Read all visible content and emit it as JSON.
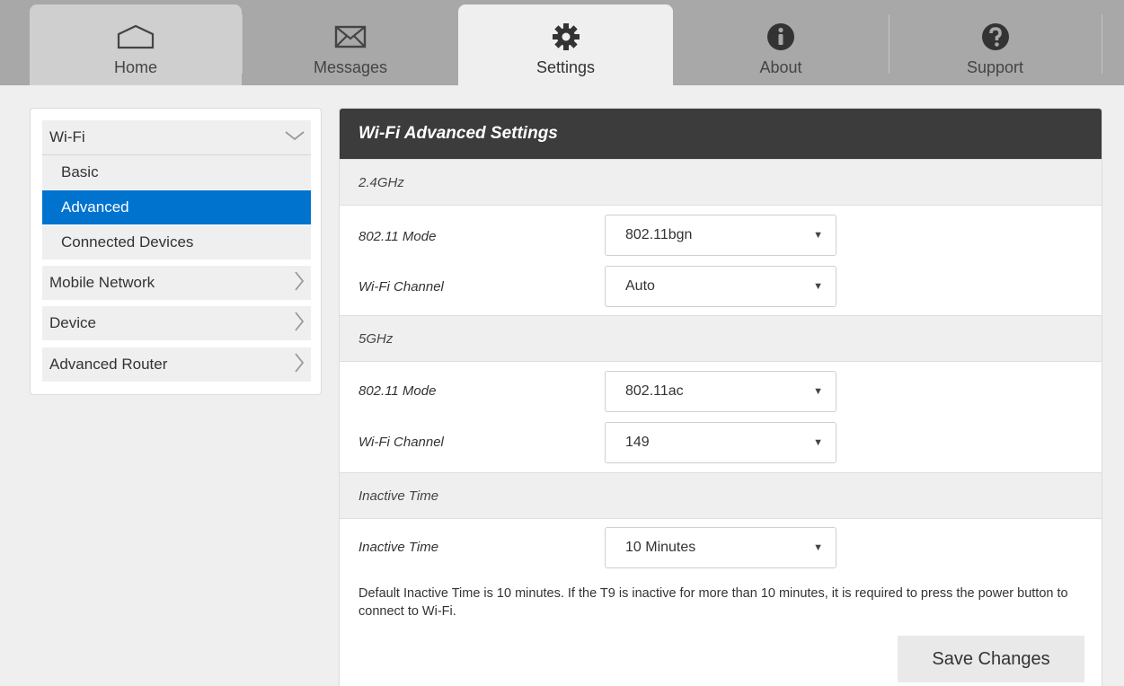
{
  "nav": {
    "tabs": [
      {
        "label": "Home",
        "icon": "home-icon"
      },
      {
        "label": "Messages",
        "icon": "envelope-icon"
      },
      {
        "label": "Settings",
        "icon": "gear-icon"
      },
      {
        "label": "About",
        "icon": "info-icon"
      },
      {
        "label": "Support",
        "icon": "question-icon"
      }
    ],
    "active": "Settings"
  },
  "sidebar": {
    "wifi": {
      "label": "Wi-Fi",
      "items": [
        "Basic",
        "Advanced",
        "Connected Devices"
      ],
      "active": "Advanced"
    },
    "groups": [
      "Mobile Network",
      "Device",
      "Advanced Router"
    ]
  },
  "panel": {
    "title": "Wi-Fi Advanced Settings",
    "sections": {
      "band24": {
        "title": "2.4GHz",
        "mode_label": "802.11 Mode",
        "mode_value": "802.11bgn",
        "channel_label": "Wi-Fi Channel",
        "channel_value": "Auto"
      },
      "band5": {
        "title": "5GHz",
        "mode_label": "802.11 Mode",
        "mode_value": "802.11ac",
        "channel_label": "Wi-Fi Channel",
        "channel_value": "149"
      },
      "inactive": {
        "title": "Inactive Time",
        "label": "Inactive Time",
        "value": "10 Minutes",
        "note": "Default Inactive Time is 10 minutes. If the T9 is inactive for more than 10 minutes, it is required to press the power button to connect to Wi-Fi."
      }
    },
    "save_label": "Save Changes"
  },
  "colors": {
    "accent": "#0073cf",
    "header": "#3c3c3c",
    "topbar": "#a8a8a8"
  }
}
